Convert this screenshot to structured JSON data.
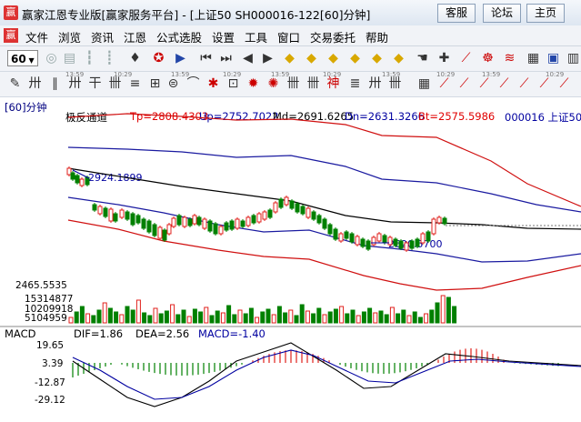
{
  "window": {
    "title": "赢家江恩专业版[赢家服务平台] - [上证50  SH000016-122[60]分钟]",
    "buttons": [
      "客服",
      "论坛",
      "主页"
    ]
  },
  "menu": [
    "文件",
    "浏览",
    "资讯",
    "江恩",
    "公式选股",
    "设置",
    "工具",
    "窗口",
    "交易委托",
    "帮助"
  ],
  "toolbar": {
    "period_value": "60",
    "period_label": "[60]分钟",
    "time_ticks": [
      "13:59",
      "10:29",
      "13:59",
      "10:29",
      "13:59",
      "10:29",
      "13:59",
      "10:29",
      "13:59",
      "10:29",
      "13:59",
      "10:29"
    ]
  },
  "indicator": {
    "name": "极反通道",
    "tp": "Tp=2808.4303",
    "up": "Up=2752.7022",
    "md": "Md=2691.6265",
    "dn": "Dn=2631.3266",
    "bt": "Bt=2575.5986",
    "symbol": "000016 上证50",
    "annot_high": "2924.1899",
    "annot_low": "2620.5700",
    "price_axis": "2465.5535",
    "vol_axis": [
      "15314877",
      "10209918",
      "5104959"
    ]
  },
  "macd": {
    "name": "MACD",
    "dif": "DIF=1.86",
    "dea": "DEA=2.56",
    "macd": "MACD=-1.40",
    "axis": [
      "19.65",
      "3.39",
      "-12.87",
      "-29.12"
    ]
  },
  "colors": {
    "up": "#e0201c",
    "down": "#008000",
    "band_red": "#d01010",
    "band_blue": "#1a1aa0",
    "mid": "#000000",
    "label_red": "#e00000",
    "label_blue": "#0000c0"
  }
}
